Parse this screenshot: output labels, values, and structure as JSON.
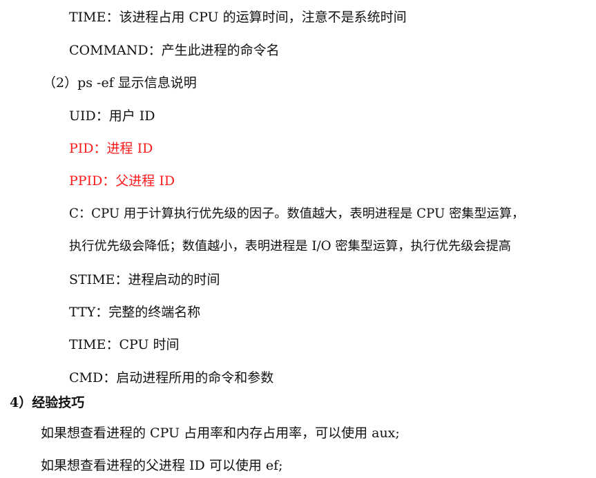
{
  "colors": {
    "text": "#111111",
    "highlight": "#ff1a1a"
  },
  "lines": {
    "time_top": "TIME：该进程占用 CPU 的运算时间，注意不是系统时间",
    "command": "COMMAND：产生此进程的命令名",
    "ps_ef_heading": "（2）ps -ef 显示信息说明",
    "uid": "UID：用户 ID",
    "pid": "PID：进程 ID",
    "ppid": "PPID：父进程 ID",
    "c_line1": "C：CPU 用于计算执行优先级的因子。数值越大，表明进程是 CPU 密集型运算，",
    "c_line2": "执行优先级会降低；数值越小，表明进程是 I/O 密集型运算，执行优先级会提高",
    "stime": "STIME：进程启动的时间",
    "tty": "TTY：完整的终端名称",
    "time": "TIME：CPU 时间",
    "cmd": "CMD：启动进程所用的命令和参数",
    "tips_heading": "4）经验技巧",
    "tip1": "如果想查看进程的 CPU 占用率和内存占用率，可以使用 aux;",
    "tip2": "如果想查看进程的父进程 ID 可以使用 ef;"
  }
}
